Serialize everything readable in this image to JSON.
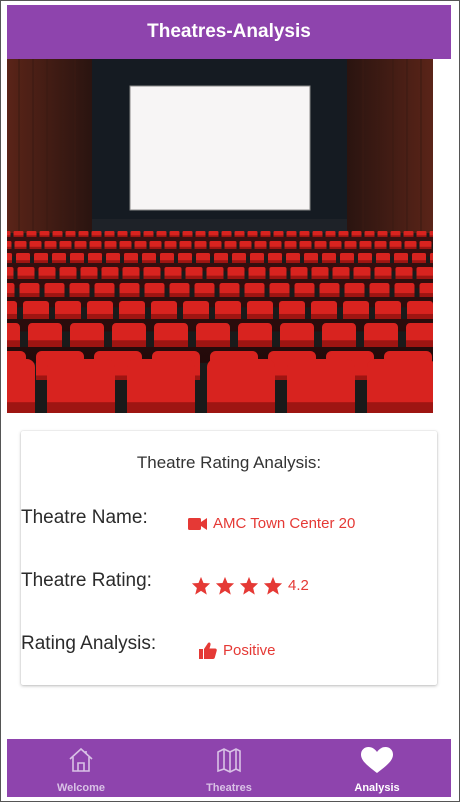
{
  "header": {
    "title": "Theatres-Analysis"
  },
  "card": {
    "title": "Theatre Rating Analysis:",
    "rows": [
      {
        "label": "Theatre Name:",
        "value": "AMC Town Center 20",
        "icon": "video-camera-icon"
      },
      {
        "label": "Theatre Rating:",
        "value": "4.2",
        "stars": 4,
        "icon": "star-icon"
      },
      {
        "label": "Rating Analysis:",
        "value": "Positive",
        "icon": "thumbs-up-icon"
      }
    ]
  },
  "tabs": [
    {
      "label": "Welcome",
      "icon": "home-icon",
      "active": false
    },
    {
      "label": "Theatres",
      "icon": "map-icon",
      "active": false
    },
    {
      "label": "Analysis",
      "icon": "heart-icon",
      "active": true
    }
  ],
  "colors": {
    "primary": "#8e44ad",
    "accent": "#e53935"
  }
}
